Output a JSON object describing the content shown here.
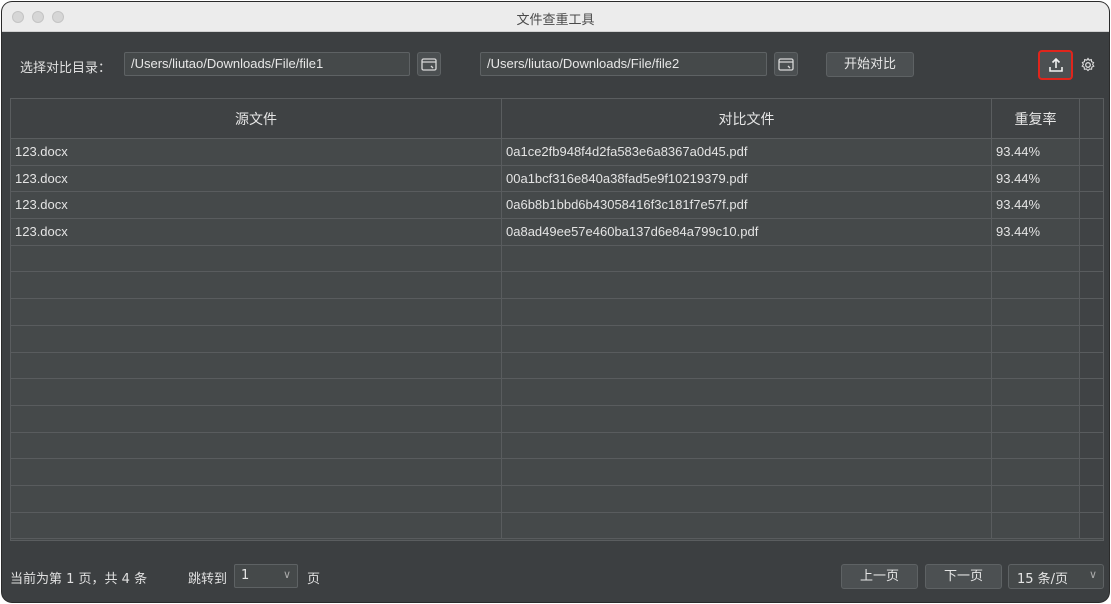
{
  "window": {
    "title": "文件查重工具"
  },
  "toolbar": {
    "dir_label": "选择对比目录：",
    "path1": "/Users/liutao/Downloads/File/file1",
    "path2": "/Users/liutao/Downloads/File/file2",
    "start_label": "开始对比",
    "icons": [
      "folder-open-icon",
      "upload-export-icon",
      "gear-icon"
    ],
    "export_highlight_color": "#e0251c"
  },
  "table": {
    "columns": [
      "源文件",
      "对比文件",
      "重复率"
    ],
    "rows": [
      [
        "123.docx",
        "0a1ce2fb948f4d2fa583e6a8367a0d45.pdf",
        "93.44%"
      ],
      [
        "123.docx",
        "00a1bcf316e840a38fad5e9f10219379.pdf",
        "93.44%"
      ],
      [
        "123.docx",
        "0a6b8b1bbd6b43058416f3c181f7e57f.pdf",
        "93.44%"
      ],
      [
        "123.docx",
        "0a8ad49ee57e460ba137d6e84a799c10.pdf",
        "93.44%"
      ]
    ]
  },
  "footer": {
    "status": "当前为第 1 页，共 4 条",
    "jump_label": "跳转到",
    "jump_value": "1",
    "page_unit": "页",
    "prev_label": "上一页",
    "next_label": "下一页",
    "page_size": "15 条/页"
  }
}
